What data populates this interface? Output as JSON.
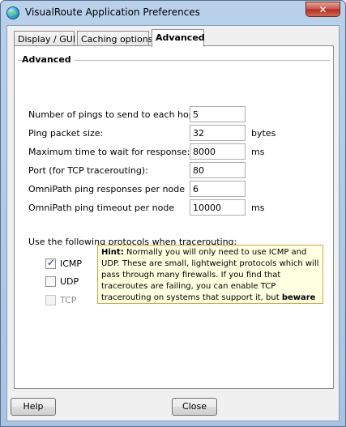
{
  "window": {
    "title": "VisualRoute Application Preferences",
    "close_label": "✕"
  },
  "tabs": [
    {
      "label": "Display / GUI"
    },
    {
      "label": "Caching options"
    },
    {
      "label": "Advanced"
    }
  ],
  "section": {
    "title": "Advanced"
  },
  "settings": [
    {
      "label": "Number of pings to send to each hop:",
      "value": "5",
      "unit": ""
    },
    {
      "label": "Ping packet size:",
      "value": "32",
      "unit": "bytes"
    },
    {
      "label": "Maximum time to wait for response:",
      "value": "8000",
      "unit": "ms"
    },
    {
      "label": "Port (for TCP tracerouting):",
      "value": "80",
      "unit": ""
    },
    {
      "label": "OmniPath ping responses per node",
      "value": "6",
      "unit": ""
    },
    {
      "label": "OmniPath ping timeout per node",
      "value": "10000",
      "unit": "ms"
    }
  ],
  "protocols": {
    "label": "Use the following protocols when tracerouting:",
    "items": [
      {
        "label": "ICMP",
        "checked": true,
        "disabled": false
      },
      {
        "label": "UDP",
        "checked": false,
        "disabled": false
      },
      {
        "label": "TCP",
        "checked": false,
        "disabled": true
      }
    ]
  },
  "hint": {
    "prefix": "Hint:",
    "text": " Normally you will only need to use ICMP and UDP. These are small, lightweight protocols which will pass through many firewalls. If you find that traceroutes are failing, you can enable TCP tracerouting on systems that support it, but ",
    "suffix": "beware"
  },
  "buttons": {
    "help": "Help",
    "close": "Close"
  }
}
